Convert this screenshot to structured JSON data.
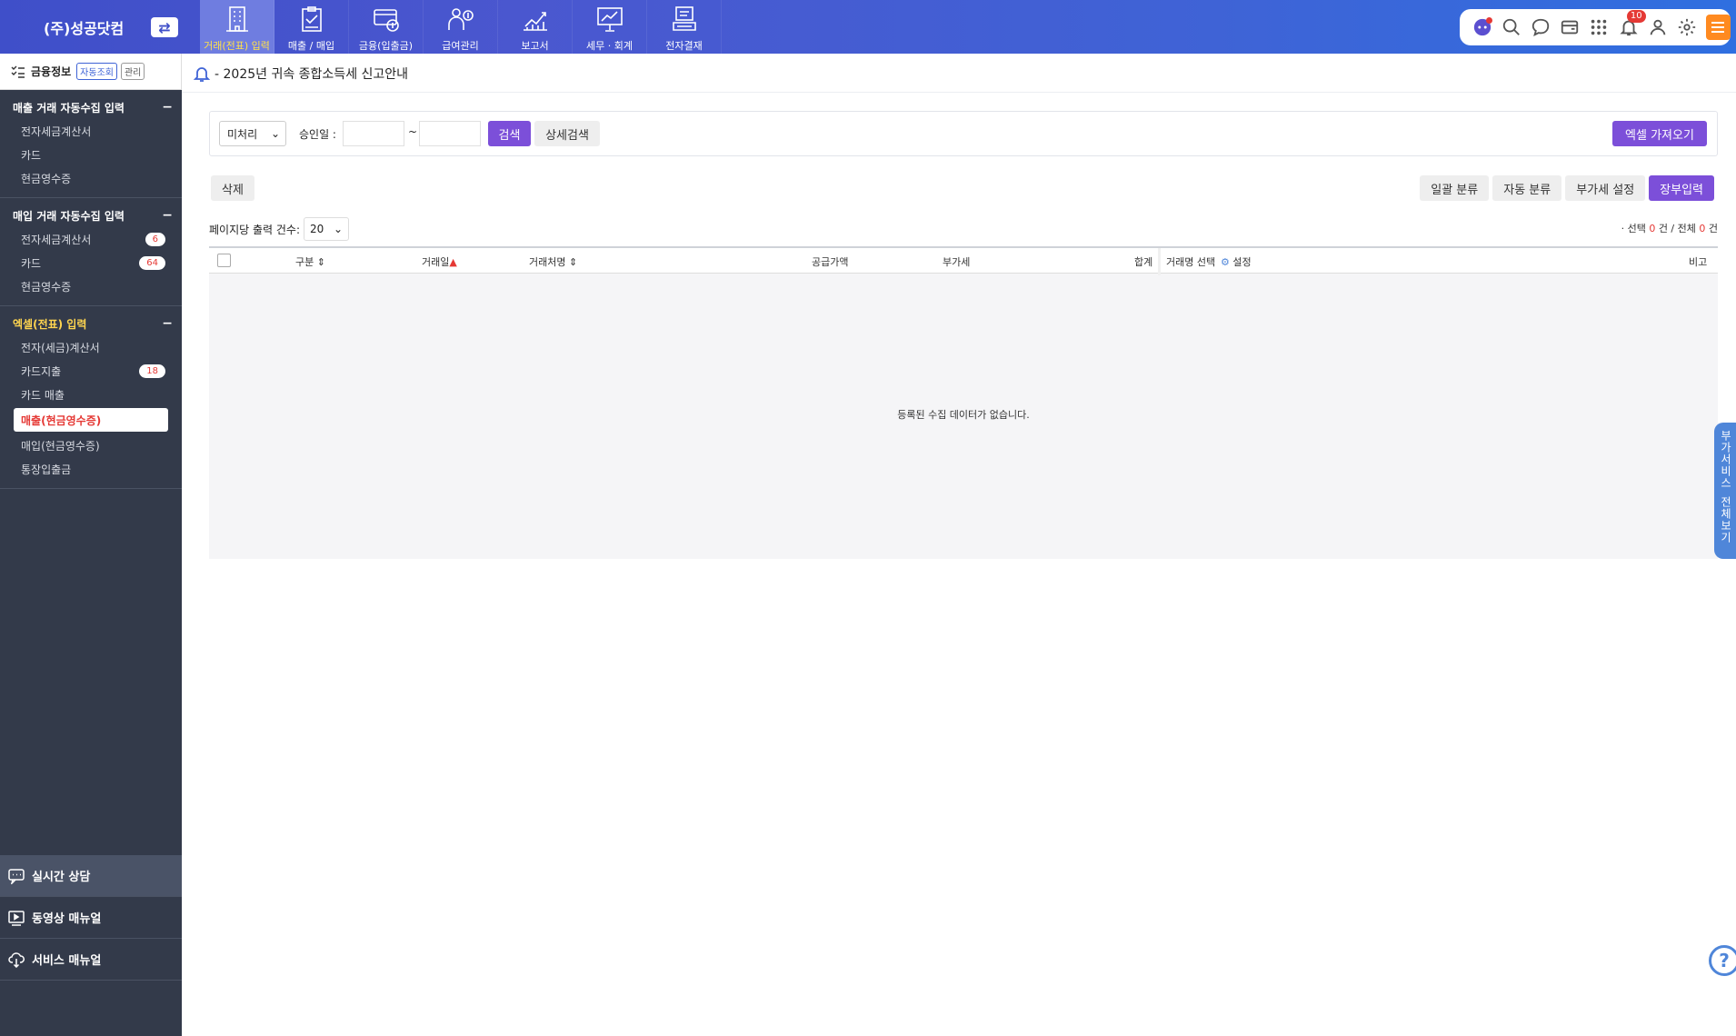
{
  "brand": {
    "name": "(주)성공닷컴",
    "switch_icon": "swap-icon"
  },
  "menus": [
    {
      "label": "거래(전표) 입력",
      "icon": "building-icon",
      "active": true
    },
    {
      "label": "매출 / 매입",
      "icon": "clipboard-check-icon"
    },
    {
      "label": "금융(입출금)",
      "icon": "card-coin-icon"
    },
    {
      "label": "급여관리",
      "icon": "payroll-icon"
    },
    {
      "label": "보고서",
      "icon": "chart-up-icon"
    },
    {
      "label": "세무 · 회계",
      "icon": "presentation-icon"
    },
    {
      "label": "전자결재",
      "icon": "approval-icon"
    }
  ],
  "tools": {
    "notification_count": "10"
  },
  "sidebar": {
    "head_title": "금융정보",
    "head_auto": "자동조회",
    "head_manage": "관리",
    "groups": [
      {
        "title": "매출 거래 자동수집 입력",
        "items": [
          {
            "label": "전자세금계산서"
          },
          {
            "label": "카드"
          },
          {
            "label": "현금영수증"
          }
        ]
      },
      {
        "title": "매입 거래 자동수집 입력",
        "items": [
          {
            "label": "전자세금계산서",
            "count": "6"
          },
          {
            "label": "카드",
            "count": "64"
          },
          {
            "label": "현금영수증"
          }
        ]
      },
      {
        "title": "엑셀(전표) 입력",
        "items": [
          {
            "label": "전자(세금)계산서"
          },
          {
            "label": "카드지출",
            "count": "18"
          },
          {
            "label": "카드 매출"
          },
          {
            "label": "매출(현금영수증)"
          },
          {
            "label": "매입(현금영수증)"
          },
          {
            "label": "통장입출금"
          }
        ]
      }
    ],
    "bottom": [
      {
        "label": "실시간 상담"
      },
      {
        "label": "동영상 매뉴얼"
      },
      {
        "label": "서비스 매뉴얼"
      }
    ]
  },
  "main": {
    "notice": "- 2025년 귀속 종합소득세 신고안내",
    "search": {
      "status_value": "미처리",
      "date_label": "승인일 :",
      "tilde": "~",
      "search_btn": "검색",
      "advanced_btn": "상세검색",
      "excel_btn": "엑셀 가져오기"
    },
    "delete_btn": "삭제",
    "actions": [
      "일괄 분류",
      "자동 분류",
      "부가세 설정",
      "장부입력"
    ],
    "perpage_label": "페이지당 출력 건수:",
    "perpage_value": "20",
    "count": {
      "prefix": "· 선택",
      "selected": "0",
      "mid": "건 / 전체",
      "total": "0",
      "suffix": "건"
    },
    "columns": {
      "type": "구분 ⇕",
      "date": "거래일",
      "vendor": "거래처명 ⇕",
      "supply": "공급가액",
      "vat": "부가세",
      "total": "합계",
      "account": "거래명 선택",
      "setting": "설정",
      "note": "비고"
    },
    "empty_message": "등록된 수집 데이터가 없습니다."
  },
  "side_tab": {
    "line1": "부가서비스",
    "line2": "전체보기"
  },
  "help": "?"
}
